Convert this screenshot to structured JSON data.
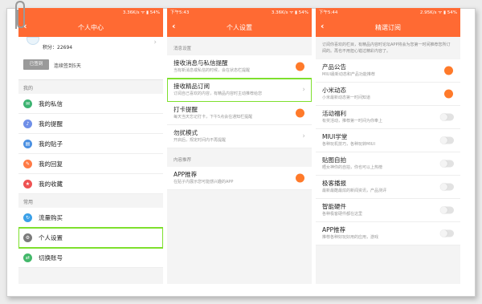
{
  "colors": {
    "accent": "#ff6a33",
    "highlight": "#7ee02e"
  },
  "panel1": {
    "status": {
      "time": "",
      "speed": "3.36K/s",
      "battery": "54%"
    },
    "title": "个人中心",
    "points": "积分：22694",
    "signed": "已签到",
    "streak": "连续签到5天",
    "section_mine": "我的",
    "section_common": "常用",
    "items_mine": [
      {
        "label": "我的私信",
        "icon": "message-icon",
        "color": "#3cb371"
      },
      {
        "label": "我的提醒",
        "icon": "bell-icon",
        "color": "#6f8fe8"
      },
      {
        "label": "我的贴子",
        "icon": "post-icon",
        "color": "#4a90e2"
      },
      {
        "label": "我的回复",
        "icon": "reply-icon",
        "color": "#ff7a45"
      },
      {
        "label": "我的收藏",
        "icon": "star-icon",
        "color": "#ee5252"
      }
    ],
    "items_common": [
      {
        "label": "流量购买",
        "icon": "data-icon",
        "color": "#3aa0e8"
      },
      {
        "label": "个人设置",
        "icon": "gear-icon",
        "color": "#7b7b7b"
      },
      {
        "label": "切换账号",
        "icon": "switch-icon",
        "color": "#43b86a"
      }
    ]
  },
  "panel2": {
    "status": {
      "time": "下午5:43",
      "speed": "3.36K/s",
      "battery": "54%"
    },
    "title": "个人设置",
    "section_msg": "消息设置",
    "section_rec": "内容推荐",
    "rows": [
      {
        "title": "接收消息与私信提醒",
        "sub": "当有新消息或私信的时候，会在状态栏提醒",
        "control": "toggle-on"
      },
      {
        "title": "接收精品订阅",
        "sub": "订阅自己喜欢的内容，有精品内容时主动推荐给您",
        "control": "chevron"
      },
      {
        "title": "打卡提醒",
        "sub": "每天当天忘记打卡，下午5点会在通知栏提醒",
        "control": "toggle-on"
      },
      {
        "title": "勿扰模式",
        "sub": "开启后，规定时间内不再提醒",
        "control": "chevron"
      }
    ],
    "rec_row": {
      "title": "APP推荐",
      "sub": "在贴子内展示您可能感兴趣的APP",
      "control": "toggle-on"
    }
  },
  "panel3": {
    "status": {
      "time": "下午5:44",
      "speed": "2.95K/s",
      "battery": "54%"
    },
    "title": "精選订阅",
    "intro": "订阅你喜欢的栏目，有精品内容时论坛APP将会为您第一时间推荐您所订阅的。再也不用担心错过精彩内容了。",
    "rows": [
      {
        "title": "产品公告",
        "sub": "MIUI最新动态和产品功能推荐",
        "control": "toggle-on"
      },
      {
        "title": "小米动态",
        "sub": "小米最新动态第一时间知道",
        "control": "toggle-on"
      },
      {
        "title": "活动福利",
        "sub": "有奖活动，推荐第一时间为你奉上",
        "control": "toggle-off"
      },
      {
        "title": "MIUI学堂",
        "sub": "各种玩机技巧，各种玩转MIUI",
        "control": "toggle-off"
      },
      {
        "title": "贴图自拍",
        "sub": "晒女神你的自拍，你也可以上热榜",
        "control": "toggle-off"
      },
      {
        "title": "极客播报",
        "sub": "最新最酷最炫的新闻资讯，产品测评",
        "control": "toggle-off"
      },
      {
        "title": "智能硬件",
        "sub": "各种极客硬件都在这里",
        "control": "toggle-off"
      },
      {
        "title": "APP推荐",
        "sub": "推荐各种好玩好用的应用，游戏",
        "control": "toggle-off"
      }
    ]
  }
}
